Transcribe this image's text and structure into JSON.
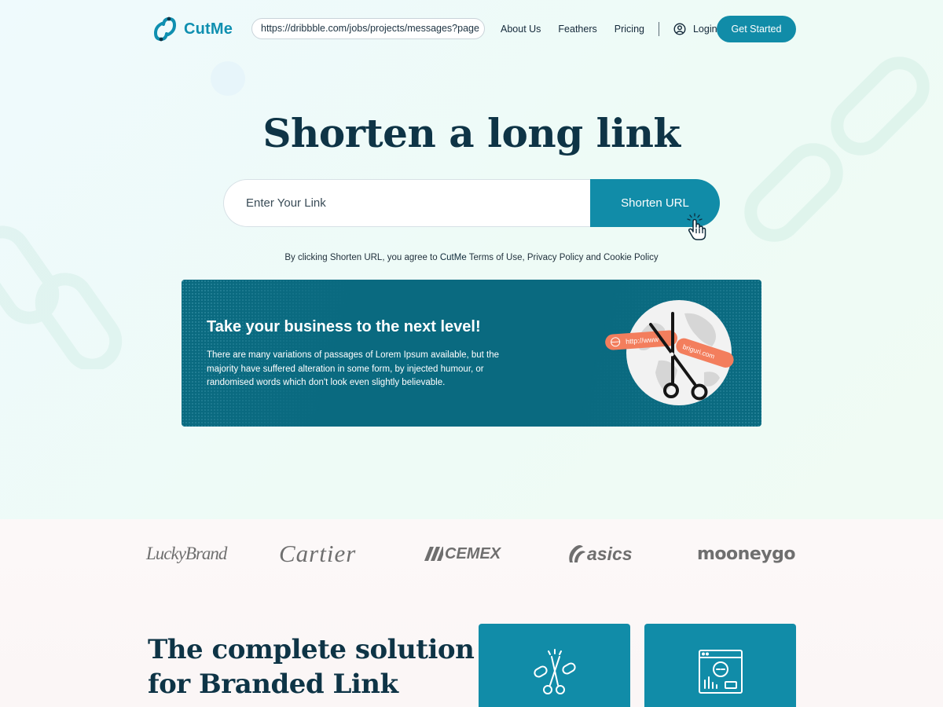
{
  "brand": {
    "name": "CutMe"
  },
  "header": {
    "url_value": "https://dribbble.com/jobs/projects/messages?page",
    "nav": [
      "About Us",
      "Feathers",
      "Pricing"
    ],
    "login_label": "Login",
    "cta_label": "Get Started"
  },
  "hero": {
    "title": "Shorten a long link",
    "input_placeholder": "Enter Your Link",
    "button_label": "Shorten URL",
    "terms_prefix": "By clicking Shorten URL, you agree to ",
    "terms_brand": "CutMe",
    "terms_suffix": " Terms of Use, Privacy Policy and Cookie Policy"
  },
  "promo": {
    "title": "Take your business to the next level!",
    "text": "There are many variations of passages of Lorem Ipsum available, but the majority have suffered alteration in some form, by injected humour, or randomised words which don't look even slightly believable.",
    "tag_left": "http://www",
    "tag_right": "briguri.com"
  },
  "brands": [
    "LuckyBrand",
    "Cartier",
    "CEMEX",
    "asics",
    "mooneygo"
  ],
  "solution": {
    "title_line1": "The complete solution",
    "title_line2": "for Branded Link"
  },
  "colors": {
    "accent": "#118ca8",
    "heading": "#0e3446",
    "banner": "#0a6a80",
    "tag": "#f37e5d"
  }
}
